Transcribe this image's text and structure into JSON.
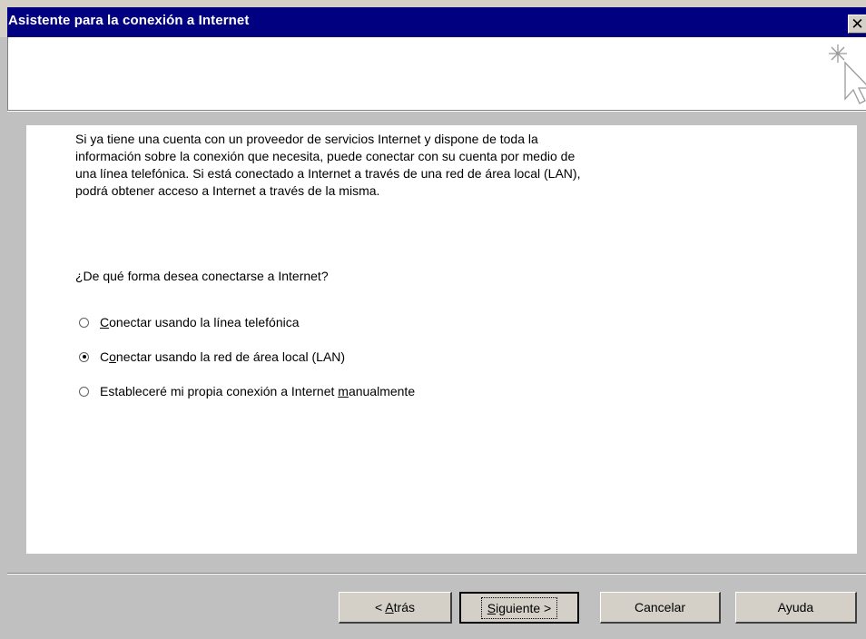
{
  "window": {
    "title": "Asistente para la conexión a Internet",
    "close_glyph": "✕"
  },
  "header": {
    "icon": "wizard-cursor-icon"
  },
  "content": {
    "intro_lines": [
      "Si ya tiene una cuenta con un proveedor de servicios Internet y dispone de toda la",
      "información sobre la conexión que necesita, puede conectar con su cuenta por medio de",
      "una línea telefónica. Si está conectado a Internet a través de una red de área local (LAN),",
      "podrá obtener acceso a Internet a través de la misma."
    ],
    "question": "¿De qué forma desea conectarse a Internet?",
    "options": [
      {
        "pre": "",
        "mnemonic": "C",
        "post": "onectar usando la línea telefónica",
        "checked": false
      },
      {
        "pre": "C",
        "mnemonic": "o",
        "post": "nectar usando la red de área local (LAN)",
        "checked": true
      },
      {
        "pre": "Estableceré mi propia conexión a Internet ",
        "mnemonic": "m",
        "post": "anualmente",
        "checked": false
      }
    ]
  },
  "buttons": {
    "back": {
      "pre": "< ",
      "mnemonic": "A",
      "post": "trás"
    },
    "next": {
      "pre": "",
      "mnemonic": "S",
      "post": "iguiente >"
    },
    "cancel": "Cancelar",
    "help": "Ayuda"
  }
}
